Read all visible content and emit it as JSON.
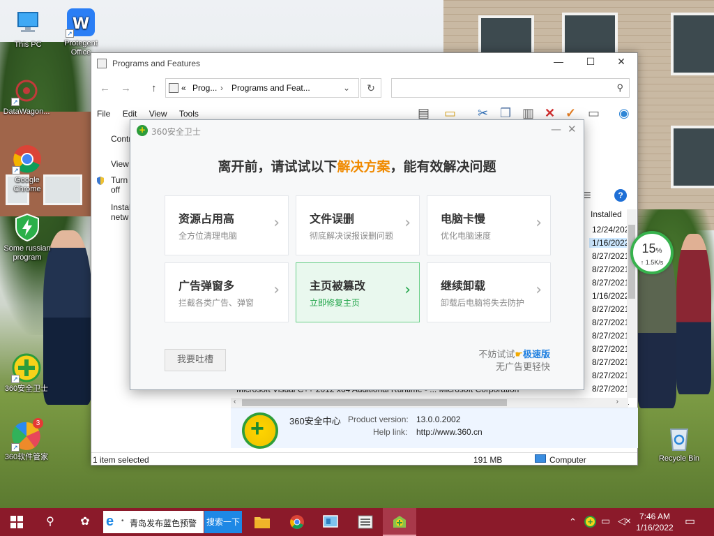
{
  "desktop": {
    "icons": [
      {
        "label": "This PC"
      },
      {
        "label": "Protegent Office"
      },
      {
        "label": "DataWagon..."
      },
      {
        "label": "Google Chrome"
      },
      {
        "label": "Some russian program"
      },
      {
        "label": "360安全卫士"
      },
      {
        "label": "360软件管家",
        "badge": "3"
      },
      {
        "label": "Recycle Bin"
      }
    ]
  },
  "programs_window": {
    "title": "Programs and Features",
    "breadcrumb": [
      "«",
      "Prog...",
      "Programs and Feat..."
    ],
    "menu": [
      "File",
      "Edit",
      "View",
      "Tools"
    ],
    "side_links": [
      "Contr",
      "View",
      "Turn",
      "off",
      "Instal",
      "netw"
    ],
    "column_header": "Installed",
    "dates": [
      "12/24/202",
      "1/16/2022",
      "8/27/2021",
      "8/27/2021",
      "8/27/2021",
      "1/16/2022",
      "8/27/2021",
      "8/27/2021",
      "8/27/2021",
      "8/27/2021",
      "8/27/2021",
      "8/27/2021",
      "8/27/2021",
      "8/27/2021"
    ],
    "selected_date_index": 1,
    "peek_row": "Microsoft Visual C++ 2012 x64 Additional Runtime - ...     Microsoft Corporation",
    "details": {
      "name": "360安全中心",
      "product_version_label": "Product version:",
      "product_version": "13.0.0.2002",
      "help_link_label": "Help link:",
      "help_link": "http://www.360.cn"
    },
    "status": {
      "selected": "1 item selected",
      "size": "191 MB",
      "location": "Computer"
    }
  },
  "dialog360": {
    "title": "360安全卫士",
    "heading_pre": "离开前，请试试以下",
    "heading_highlight": "解决方案",
    "heading_post": "，能有效解决问题",
    "cards": [
      {
        "title": "资源占用高",
        "subtitle": "全方位清理电脑"
      },
      {
        "title": "文件误删",
        "subtitle": "彻底解决误报误删问题"
      },
      {
        "title": "电脑卡慢",
        "subtitle": "优化电脑速度"
      },
      {
        "title": "广告弹窗多",
        "subtitle": "拦截各类广告、弹窗"
      },
      {
        "title": "主页被篡改",
        "subtitle": "立即修复主页"
      },
      {
        "title": "继续卸载",
        "subtitle": "卸载后电脑将失去防护"
      }
    ],
    "active_card": 4,
    "feedback_button": "我要吐槽",
    "try_prefix": "不妨试试",
    "try_link": "极速版",
    "try_note": "无广告更轻快",
    "accent_color": "#f08a00",
    "active_color": "#21a54a"
  },
  "net_widget": {
    "percent": "15",
    "percent_unit": "%",
    "speed": "↑ 1.5K/s"
  },
  "taskbar": {
    "search_text": "青岛发布蓝色预警",
    "search_button": "搜索一下",
    "time": "7:46 AM",
    "date": "1/16/2022",
    "color": "#8b1a2a"
  }
}
